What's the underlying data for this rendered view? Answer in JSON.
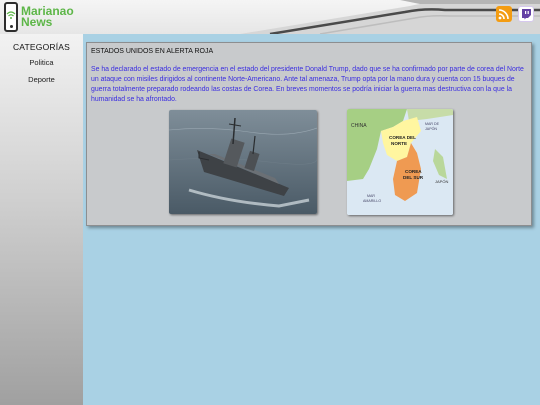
{
  "header": {
    "logo_line1": "Marianao",
    "logo_line2": "News",
    "rss_icon": "rss-icon",
    "twitch_icon": "twitch-icon"
  },
  "sidebar": {
    "title": "CATEGORÍAS",
    "items": [
      {
        "label": "Politica"
      },
      {
        "label": "Deporte"
      }
    ]
  },
  "article": {
    "title": "ESTADOS UNIDOS EN ALERTA ROJA",
    "body": "Se ha declarado el estado de emergencia en el estado del presidente Donald Trump, dado que se ha confirmado por parte de corea del Norte un ataque con misiles dirigidos al continente Norte-Americano. Ante tal amenaza, Trump opta por la mano dura y cuenta con 15 buques de guerra totalmente preparado rodeando las costas de Corea. En breves momentos se podría iniciar la guerra mas destructiva con la que la humanidad se ha afrontado.",
    "map_labels": {
      "china": "CHINA",
      "north_korea_1": "COREA DEL",
      "north_korea_2": "NORTE",
      "south_korea_1": "COREA",
      "south_korea_2": "DEL SUR",
      "japan": "JAPÓN",
      "sea_japan_1": "MAR DE",
      "sea_japan_2": "JAPÓN",
      "yellow_sea_1": "MAR",
      "yellow_sea_2": "AMARILLO"
    }
  },
  "colors": {
    "brand_green": "#5db648",
    "body_text": "#3a2de0",
    "background": "#a9d1e4"
  }
}
